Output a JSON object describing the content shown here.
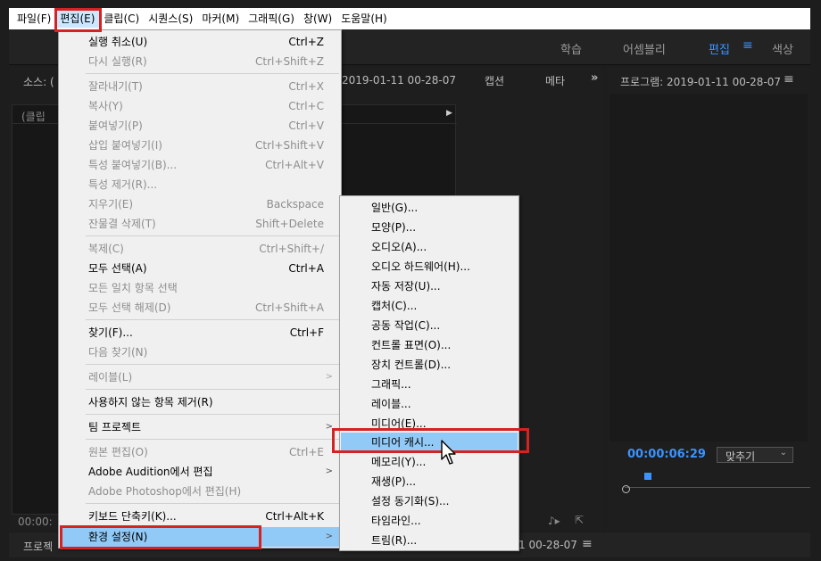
{
  "menubar": {
    "items": [
      {
        "label": "파일(F)"
      },
      {
        "label": "편집(E)"
      },
      {
        "label": "클립(C)"
      },
      {
        "label": "시퀀스(S)"
      },
      {
        "label": "마커(M)"
      },
      {
        "label": "그래픽(G)"
      },
      {
        "label": "창(W)"
      },
      {
        "label": "도움말(H)"
      }
    ]
  },
  "workspaces": {
    "items": [
      "학습",
      "어셈블리",
      "편집",
      "색상"
    ],
    "active": "편집"
  },
  "source_panel": {
    "title": "소스: (",
    "clip_title": "2019-01-11 00-28-07",
    "tab_captions": "캡션",
    "tab_meta": "메타",
    "clip_label": "(클립 ",
    "timecode": "00:00:"
  },
  "program_panel": {
    "title": "프로그램: 2019-01-11 00-28-07",
    "timecode": "00:00:06:29",
    "fit_select": "맞추기"
  },
  "bottom_bar": {
    "project_label": "프로젝",
    "sequence_label": "1 00-28-07"
  },
  "edit_menu": {
    "items": [
      {
        "label": "실행 취소(U)",
        "shortcut": "Ctrl+Z",
        "disabled": false
      },
      {
        "label": "다시 실행(R)",
        "shortcut": "Ctrl+Shift+Z",
        "disabled": true
      },
      {
        "label": "잘라내기(T)",
        "shortcut": "Ctrl+X",
        "disabled": true
      },
      {
        "label": "복사(Y)",
        "shortcut": "Ctrl+C",
        "disabled": true
      },
      {
        "label": "붙여넣기(P)",
        "shortcut": "Ctrl+V",
        "disabled": true
      },
      {
        "label": "삽입 붙여넣기(I)",
        "shortcut": "Ctrl+Shift+V",
        "disabled": true
      },
      {
        "label": "특성 붙여넣기(B)...",
        "shortcut": "Ctrl+Alt+V",
        "disabled": true
      },
      {
        "label": "특성 제거(R)...",
        "shortcut": "",
        "disabled": true
      },
      {
        "label": "지우기(E)",
        "shortcut": "Backspace",
        "disabled": true
      },
      {
        "label": "잔물결 삭제(T)",
        "shortcut": "Shift+Delete",
        "disabled": true
      },
      {
        "label": "복제(C)",
        "shortcut": "Ctrl+Shift+/",
        "disabled": true
      },
      {
        "label": "모두 선택(A)",
        "shortcut": "Ctrl+A",
        "disabled": false
      },
      {
        "label": "모든 일치 항목 선택",
        "shortcut": "",
        "disabled": true
      },
      {
        "label": "모두 선택 해제(D)",
        "shortcut": "Ctrl+Shift+A",
        "disabled": true
      },
      {
        "label": "찾기(F)...",
        "shortcut": "Ctrl+F",
        "disabled": false
      },
      {
        "label": "다음 찾기(N)",
        "shortcut": "",
        "disabled": true
      },
      {
        "label": "레이블(L)",
        "shortcut": "",
        "disabled": true
      },
      {
        "label": "사용하지 않는 항목 제거(R)",
        "shortcut": "",
        "disabled": false
      },
      {
        "label": "팀 프로젝트",
        "shortcut": "",
        "disabled": false
      },
      {
        "label": "원본 편집(O)",
        "shortcut": "Ctrl+E",
        "disabled": true
      },
      {
        "label": "Adobe Audition에서 편집",
        "shortcut": "",
        "disabled": false
      },
      {
        "label": "Adobe Photoshop에서 편집(H)",
        "shortcut": "",
        "disabled": true
      },
      {
        "label": "키보드 단축키(K)...",
        "shortcut": "Ctrl+Alt+K",
        "disabled": false
      },
      {
        "label": "환경 설정(N)",
        "shortcut": "",
        "disabled": false,
        "highlighted": true
      }
    ]
  },
  "pref_submenu": {
    "items": [
      {
        "label": "일반(G)..."
      },
      {
        "label": "모양(P)..."
      },
      {
        "label": "오디오(A)..."
      },
      {
        "label": "오디오 하드웨어(H)..."
      },
      {
        "label": "자동 저장(U)..."
      },
      {
        "label": "캡처(C)..."
      },
      {
        "label": "공동 작업(C)..."
      },
      {
        "label": "컨트롤 표면(O)..."
      },
      {
        "label": "장치 컨트롤(D)..."
      },
      {
        "label": "그래픽..."
      },
      {
        "label": "레이블..."
      },
      {
        "label": "미디어(E)..."
      },
      {
        "label": "미디어 캐시...",
        "highlighted": true
      },
      {
        "label": "메모리(Y)..."
      },
      {
        "label": "재생(P)..."
      },
      {
        "label": "설정 동기화(S)..."
      },
      {
        "label": "타임라인..."
      },
      {
        "label": "트림(R)..."
      }
    ]
  },
  "colors": {
    "highlight_red": "#d32323",
    "menu_hover": "#91c9f7",
    "accent_blue": "#3a93ff"
  }
}
